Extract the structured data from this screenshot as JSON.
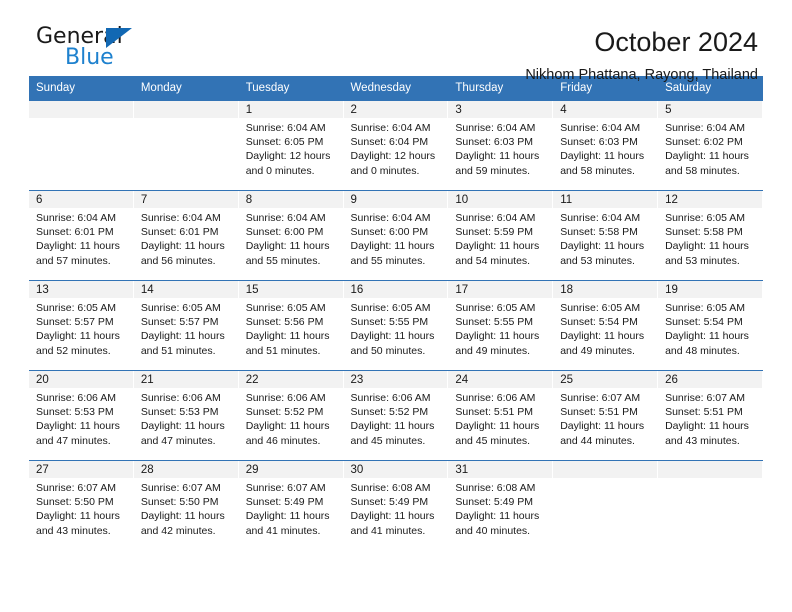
{
  "brand": {
    "name_top": "General",
    "name_bottom": "Blue",
    "accent_color": "#1e81ce",
    "triangle_color": "#1268b3"
  },
  "header": {
    "title": "October 2024",
    "subtitle": "Nikhom Phattana, Rayong, Thailand"
  },
  "theme": {
    "header_row_bg": "#3273b5",
    "daynum_band_bg": "#f2f2f2",
    "separator_color": "#3273b5",
    "text_color": "#1a1a1a"
  },
  "calendar": {
    "weekday_headers": [
      "Sunday",
      "Monday",
      "Tuesday",
      "Wednesday",
      "Thursday",
      "Friday",
      "Saturday"
    ],
    "weeks": [
      [
        {
          "day": "",
          "blank": true,
          "sunrise": "",
          "sunset": "",
          "daylight_line1": "",
          "daylight_line2": ""
        },
        {
          "day": "",
          "blank": true,
          "sunrise": "",
          "sunset": "",
          "daylight_line1": "",
          "daylight_line2": ""
        },
        {
          "day": "1",
          "blank": false,
          "sunrise": "Sunrise: 6:04 AM",
          "sunset": "Sunset: 6:05 PM",
          "daylight_line1": "Daylight: 12 hours",
          "daylight_line2": "and 0 minutes."
        },
        {
          "day": "2",
          "blank": false,
          "sunrise": "Sunrise: 6:04 AM",
          "sunset": "Sunset: 6:04 PM",
          "daylight_line1": "Daylight: 12 hours",
          "daylight_line2": "and 0 minutes."
        },
        {
          "day": "3",
          "blank": false,
          "sunrise": "Sunrise: 6:04 AM",
          "sunset": "Sunset: 6:03 PM",
          "daylight_line1": "Daylight: 11 hours",
          "daylight_line2": "and 59 minutes."
        },
        {
          "day": "4",
          "blank": false,
          "sunrise": "Sunrise: 6:04 AM",
          "sunset": "Sunset: 6:03 PM",
          "daylight_line1": "Daylight: 11 hours",
          "daylight_line2": "and 58 minutes."
        },
        {
          "day": "5",
          "blank": false,
          "sunrise": "Sunrise: 6:04 AM",
          "sunset": "Sunset: 6:02 PM",
          "daylight_line1": "Daylight: 11 hours",
          "daylight_line2": "and 58 minutes."
        }
      ],
      [
        {
          "day": "6",
          "blank": false,
          "sunrise": "Sunrise: 6:04 AM",
          "sunset": "Sunset: 6:01 PM",
          "daylight_line1": "Daylight: 11 hours",
          "daylight_line2": "and 57 minutes."
        },
        {
          "day": "7",
          "blank": false,
          "sunrise": "Sunrise: 6:04 AM",
          "sunset": "Sunset: 6:01 PM",
          "daylight_line1": "Daylight: 11 hours",
          "daylight_line2": "and 56 minutes."
        },
        {
          "day": "8",
          "blank": false,
          "sunrise": "Sunrise: 6:04 AM",
          "sunset": "Sunset: 6:00 PM",
          "daylight_line1": "Daylight: 11 hours",
          "daylight_line2": "and 55 minutes."
        },
        {
          "day": "9",
          "blank": false,
          "sunrise": "Sunrise: 6:04 AM",
          "sunset": "Sunset: 6:00 PM",
          "daylight_line1": "Daylight: 11 hours",
          "daylight_line2": "and 55 minutes."
        },
        {
          "day": "10",
          "blank": false,
          "sunrise": "Sunrise: 6:04 AM",
          "sunset": "Sunset: 5:59 PM",
          "daylight_line1": "Daylight: 11 hours",
          "daylight_line2": "and 54 minutes."
        },
        {
          "day": "11",
          "blank": false,
          "sunrise": "Sunrise: 6:04 AM",
          "sunset": "Sunset: 5:58 PM",
          "daylight_line1": "Daylight: 11 hours",
          "daylight_line2": "and 53 minutes."
        },
        {
          "day": "12",
          "blank": false,
          "sunrise": "Sunrise: 6:05 AM",
          "sunset": "Sunset: 5:58 PM",
          "daylight_line1": "Daylight: 11 hours",
          "daylight_line2": "and 53 minutes."
        }
      ],
      [
        {
          "day": "13",
          "blank": false,
          "sunrise": "Sunrise: 6:05 AM",
          "sunset": "Sunset: 5:57 PM",
          "daylight_line1": "Daylight: 11 hours",
          "daylight_line2": "and 52 minutes."
        },
        {
          "day": "14",
          "blank": false,
          "sunrise": "Sunrise: 6:05 AM",
          "sunset": "Sunset: 5:57 PM",
          "daylight_line1": "Daylight: 11 hours",
          "daylight_line2": "and 51 minutes."
        },
        {
          "day": "15",
          "blank": false,
          "sunrise": "Sunrise: 6:05 AM",
          "sunset": "Sunset: 5:56 PM",
          "daylight_line1": "Daylight: 11 hours",
          "daylight_line2": "and 51 minutes."
        },
        {
          "day": "16",
          "blank": false,
          "sunrise": "Sunrise: 6:05 AM",
          "sunset": "Sunset: 5:55 PM",
          "daylight_line1": "Daylight: 11 hours",
          "daylight_line2": "and 50 minutes."
        },
        {
          "day": "17",
          "blank": false,
          "sunrise": "Sunrise: 6:05 AM",
          "sunset": "Sunset: 5:55 PM",
          "daylight_line1": "Daylight: 11 hours",
          "daylight_line2": "and 49 minutes."
        },
        {
          "day": "18",
          "blank": false,
          "sunrise": "Sunrise: 6:05 AM",
          "sunset": "Sunset: 5:54 PM",
          "daylight_line1": "Daylight: 11 hours",
          "daylight_line2": "and 49 minutes."
        },
        {
          "day": "19",
          "blank": false,
          "sunrise": "Sunrise: 6:05 AM",
          "sunset": "Sunset: 5:54 PM",
          "daylight_line1": "Daylight: 11 hours",
          "daylight_line2": "and 48 minutes."
        }
      ],
      [
        {
          "day": "20",
          "blank": false,
          "sunrise": "Sunrise: 6:06 AM",
          "sunset": "Sunset: 5:53 PM",
          "daylight_line1": "Daylight: 11 hours",
          "daylight_line2": "and 47 minutes."
        },
        {
          "day": "21",
          "blank": false,
          "sunrise": "Sunrise: 6:06 AM",
          "sunset": "Sunset: 5:53 PM",
          "daylight_line1": "Daylight: 11 hours",
          "daylight_line2": "and 47 minutes."
        },
        {
          "day": "22",
          "blank": false,
          "sunrise": "Sunrise: 6:06 AM",
          "sunset": "Sunset: 5:52 PM",
          "daylight_line1": "Daylight: 11 hours",
          "daylight_line2": "and 46 minutes."
        },
        {
          "day": "23",
          "blank": false,
          "sunrise": "Sunrise: 6:06 AM",
          "sunset": "Sunset: 5:52 PM",
          "daylight_line1": "Daylight: 11 hours",
          "daylight_line2": "and 45 minutes."
        },
        {
          "day": "24",
          "blank": false,
          "sunrise": "Sunrise: 6:06 AM",
          "sunset": "Sunset: 5:51 PM",
          "daylight_line1": "Daylight: 11 hours",
          "daylight_line2": "and 45 minutes."
        },
        {
          "day": "25",
          "blank": false,
          "sunrise": "Sunrise: 6:07 AM",
          "sunset": "Sunset: 5:51 PM",
          "daylight_line1": "Daylight: 11 hours",
          "daylight_line2": "and 44 minutes."
        },
        {
          "day": "26",
          "blank": false,
          "sunrise": "Sunrise: 6:07 AM",
          "sunset": "Sunset: 5:51 PM",
          "daylight_line1": "Daylight: 11 hours",
          "daylight_line2": "and 43 minutes."
        }
      ],
      [
        {
          "day": "27",
          "blank": false,
          "sunrise": "Sunrise: 6:07 AM",
          "sunset": "Sunset: 5:50 PM",
          "daylight_line1": "Daylight: 11 hours",
          "daylight_line2": "and 43 minutes."
        },
        {
          "day": "28",
          "blank": false,
          "sunrise": "Sunrise: 6:07 AM",
          "sunset": "Sunset: 5:50 PM",
          "daylight_line1": "Daylight: 11 hours",
          "daylight_line2": "and 42 minutes."
        },
        {
          "day": "29",
          "blank": false,
          "sunrise": "Sunrise: 6:07 AM",
          "sunset": "Sunset: 5:49 PM",
          "daylight_line1": "Daylight: 11 hours",
          "daylight_line2": "and 41 minutes."
        },
        {
          "day": "30",
          "blank": false,
          "sunrise": "Sunrise: 6:08 AM",
          "sunset": "Sunset: 5:49 PM",
          "daylight_line1": "Daylight: 11 hours",
          "daylight_line2": "and 41 minutes."
        },
        {
          "day": "31",
          "blank": false,
          "sunrise": "Sunrise: 6:08 AM",
          "sunset": "Sunset: 5:49 PM",
          "daylight_line1": "Daylight: 11 hours",
          "daylight_line2": "and 40 minutes."
        },
        {
          "day": "",
          "blank": true,
          "sunrise": "",
          "sunset": "",
          "daylight_line1": "",
          "daylight_line2": ""
        },
        {
          "day": "",
          "blank": true,
          "sunrise": "",
          "sunset": "",
          "daylight_line1": "",
          "daylight_line2": ""
        }
      ]
    ]
  }
}
